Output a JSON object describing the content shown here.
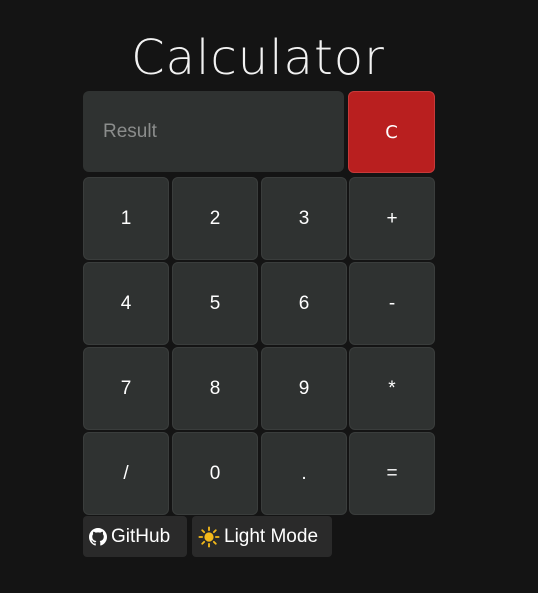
{
  "title": "Calculator",
  "result": {
    "placeholder": "Result",
    "value": ""
  },
  "clear_label": "C",
  "keys": [
    [
      "1",
      "2",
      "3",
      "+"
    ],
    [
      "4",
      "5",
      "6",
      "-"
    ],
    [
      "7",
      "8",
      "9",
      "*"
    ],
    [
      "/",
      "0",
      ".",
      "="
    ]
  ],
  "footer": {
    "github_label": "GitHub",
    "github_icon": "github-icon",
    "theme_label": "Light Mode",
    "theme_icon": "sun-icon"
  },
  "colors": {
    "background": "#141414",
    "key": "#2f3231",
    "clear": "#b91f1f",
    "sun": "#f4b91a"
  }
}
